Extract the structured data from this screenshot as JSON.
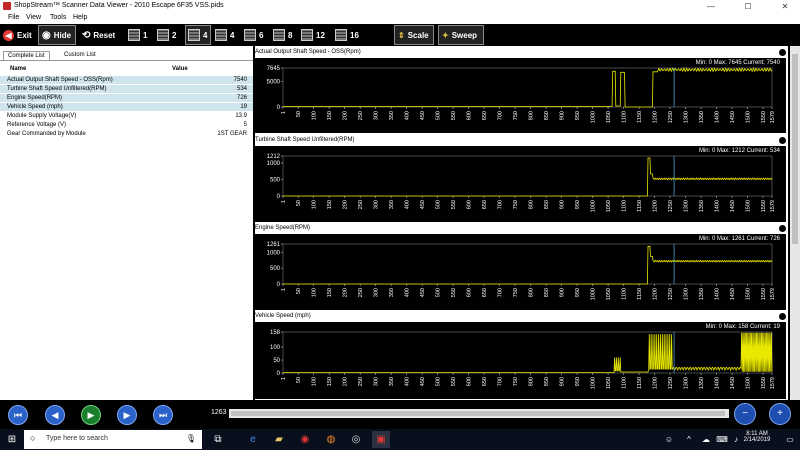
{
  "window": {
    "title": "ShopStream™ Scanner Data Viewer - 2010 Escape 6F35 VSS.pids",
    "controls": [
      "—",
      "☐",
      "✕"
    ]
  },
  "menu": [
    "File",
    "View",
    "Tools",
    "Help"
  ],
  "toolbar": {
    "exit": "Exit",
    "hide": "Hide",
    "reset": "Reset",
    "layouts": [
      "1",
      "2",
      "4",
      "4",
      "6",
      "8",
      "12",
      "16"
    ],
    "scale": "Scale",
    "sweep": "Sweep"
  },
  "left_panel": {
    "tabs": [
      "Complete List",
      "Custom List"
    ],
    "headers": {
      "name": "Name",
      "value": "Value"
    },
    "rows": [
      {
        "name": "Actual Output Shaft Speed - OSS(Rpm)",
        "value": "7540"
      },
      {
        "name": "Turbine Shaft Speed Unfiltered(RPM)",
        "value": "534"
      },
      {
        "name": "Engine Speed(RPM)",
        "value": "726"
      },
      {
        "name": "Vehicle Speed (mph)",
        "value": "19"
      },
      {
        "name": "Module Supply Voltage(V)",
        "value": "13.9"
      },
      {
        "name": "Reference Voltage (V)",
        "value": "5"
      },
      {
        "name": "Gear Commanded by Module",
        "value": "1ST GEAR"
      }
    ]
  },
  "x_ticks": [
    "1",
    "50",
    "100",
    "150",
    "200",
    "250",
    "300",
    "350",
    "400",
    "450",
    "500",
    "550",
    "600",
    "650",
    "700",
    "750",
    "800",
    "850",
    "900",
    "950",
    "1000",
    "1050",
    "1100",
    "1150",
    "1200",
    "1250",
    "1300",
    "1350",
    "1400",
    "1450",
    "1500",
    "1550",
    "1579"
  ],
  "cursor_sample": 1263,
  "graphs": [
    {
      "title": "Actual Output Shaft Speed - OSS(Rpm)",
      "stats": "Min: 0    Max: 7645    Current: 7540",
      "y_ticks": [
        "7645",
        "5000",
        "0"
      ],
      "ymax": 7645
    },
    {
      "title": "Turbine Shaft Speed Unfiltered(RPM)",
      "stats": "Min: 0    Max: 1212    Current: 534",
      "y_ticks": [
        "1212",
        "1000",
        "500",
        "0"
      ],
      "ymax": 1212
    },
    {
      "title": "Engine Speed(RPM)",
      "stats": "Min: 0    Max: 1261    Current: 726",
      "y_ticks": [
        "1261",
        "1000",
        "500",
        "0"
      ],
      "ymax": 1261
    },
    {
      "title": "Vehicle Speed (mph)",
      "stats": "Min: 0    Max: 158    Current: 19",
      "y_ticks": [
        "158",
        "100",
        "50",
        "0"
      ],
      "ymax": 158
    }
  ],
  "colors": {
    "trace": "#e8e800",
    "cursor": "#4aa3c8",
    "highlight": "#cfe4ec"
  },
  "taskbar": {
    "search_placeholder": "Type here to search",
    "time": "8:11 AM",
    "date": "2/14/2019"
  }
}
